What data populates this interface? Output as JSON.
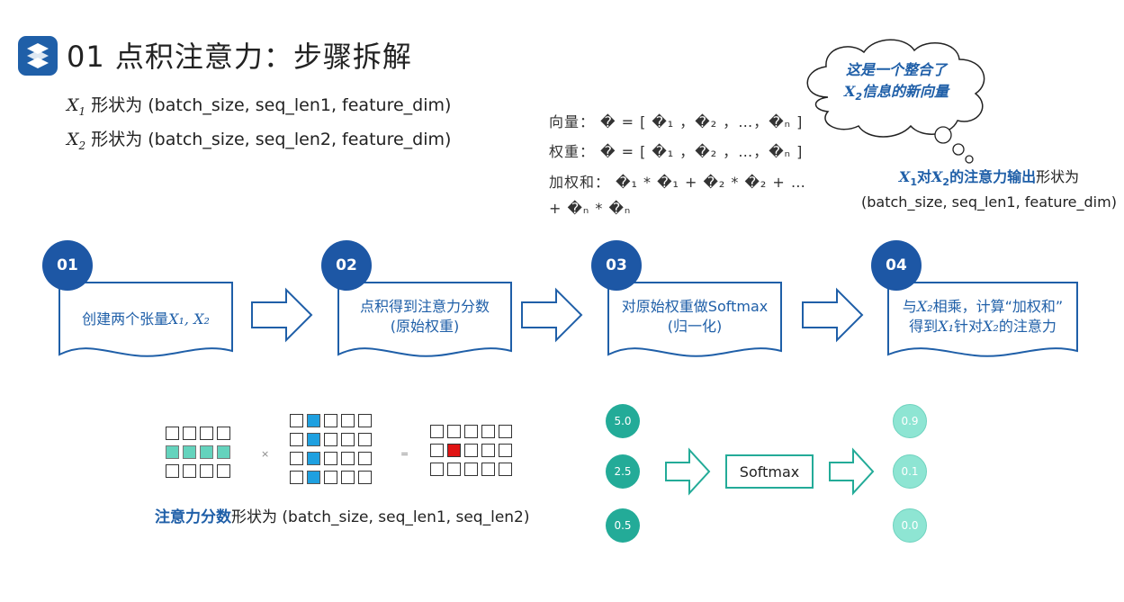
{
  "title": "01 点积注意力：步骤拆解",
  "shapes": [
    {
      "var": "X",
      "sub": "1",
      "text": "形状为 (batch_size, seq_len1, feature_dim)"
    },
    {
      "var": "X",
      "sub": "2",
      "text": "形状为 (batch_size, seq_len2, feature_dim)"
    }
  ],
  "formulas": {
    "vector": "向量： � = [ �₁ ，�₂ ，…，�ₙ ]",
    "weights": "权重： � = [ �₁ ，�₂ ，…，�ₙ ]",
    "weighted_sum_1": "加权和： �₁  * �₁  + �₂  * �₂  + …",
    "weighted_sum_2": "+ �ₙ  * �ₙ"
  },
  "cloud": {
    "line1": "这是一个整合了",
    "line2_var": "X",
    "line2_sub": "2",
    "line2_text": "信息的新向量"
  },
  "output": {
    "var1": "X",
    "sub1": "1",
    "mid": "对",
    "var2": "X",
    "sub2": "2",
    "highlight": "的注意力输出",
    "suffix": "形状为",
    "shape": "(batch_size, seq_len1, feature_dim)"
  },
  "steps": [
    {
      "num": "01",
      "text": "创建两个张量",
      "math": "X₁, X₂"
    },
    {
      "num": "02",
      "line1": "点积得到注意力分数",
      "line2": "(原始权重)"
    },
    {
      "num": "03",
      "line1": "对原始权重做Softmax",
      "line2": "(归一化)"
    },
    {
      "num": "04",
      "line1_a": "与",
      "line1_var": "X₂",
      "line1_b": "相乘，计算“加权和”",
      "line2_a": "得到",
      "line2_var1": "X₁",
      "line2_b": "针对",
      "line2_var2": "X₂",
      "line2_c": "的注意力"
    }
  ],
  "matrix_ops": {
    "times": "×",
    "equals": "="
  },
  "score_label": {
    "highlight": "注意力分数",
    "text": "形状为 (batch_size, seq_len1, seq_len2)"
  },
  "softmax_example": {
    "inputs": [
      "5.0",
      "2.5",
      "0.5"
    ],
    "box": "Softmax",
    "outputs": [
      "0.9",
      "0.1",
      "0.0"
    ]
  },
  "colors": {
    "brand_blue": "#1d57a5",
    "teal": "#23ab98",
    "light_teal": "#8ee5d3",
    "matrix_teal": "#64d3bd",
    "matrix_blue": "#1ea0e0",
    "highlight_red": "#e01414"
  }
}
